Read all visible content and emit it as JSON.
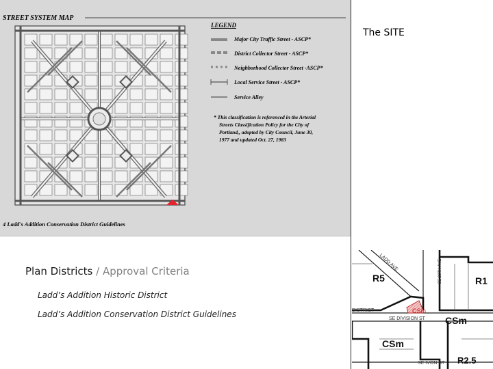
{
  "map": {
    "title": "STREET SYSTEM MAP",
    "legend_title": "LEGEND",
    "legend_items": [
      "Major City Traffic Street - ASCP*",
      "District Collector Street - ASCP*",
      "Neighborhood Collector Street -ASCP*",
      "Local Service Street - ASCP*",
      "Service Alley"
    ],
    "footnote": [
      "* This classification is referenced in the Arterial",
      "Streets Classification Policy for the City of",
      "Portland,, adopted by City Council, June 30,",
      "1977 and updated Oct. 27, 1983"
    ],
    "page_caption": "4  Ladd's Addition Conservation District Guidelines",
    "marker_color": "#e8212a"
  },
  "site": {
    "title": "The SITE"
  },
  "plan": {
    "heading_main": "Plan Districts",
    "heading_sep": " / ",
    "heading_muted": "Approval Criteria",
    "criteria": [
      "Ladd’s Addition Historic District",
      "Ladd’s Addition Conservation District Guidelines"
    ]
  },
  "zoning": {
    "labels": {
      "r5": "R5",
      "r1": "R1",
      "csm_site": "CSm",
      "csm_right": "CSm",
      "csm_bottom": "CSm",
      "r25": "R2.5"
    },
    "streets": {
      "ladd": "LADD AVE",
      "division": "SE DIVISION ST",
      "ivon": "SE IVON ST",
      "district": "DISTRICT",
      "ave_20": "SE 20TH AVE"
    },
    "site_color": "#e8a0a0"
  }
}
